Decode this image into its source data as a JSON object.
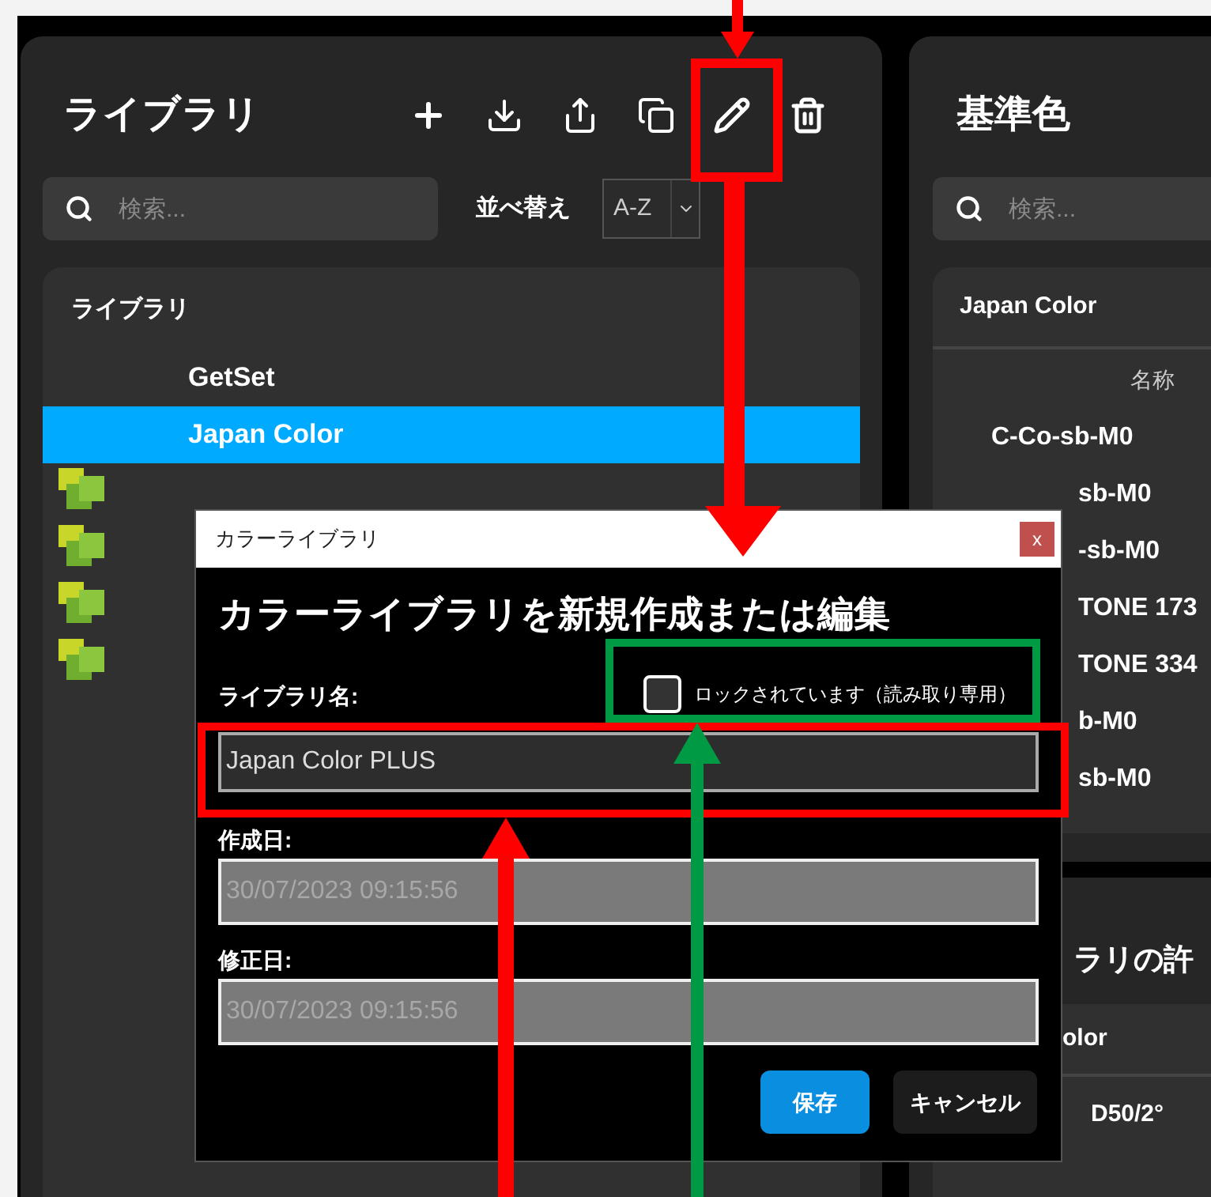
{
  "left_panel": {
    "title": "ライブラリ",
    "search": {
      "placeholder": "検索..."
    },
    "sort": {
      "label": "並べ替え",
      "value": "A-Z"
    },
    "list": {
      "header": "ライブラリ",
      "items": [
        {
          "name": "GetSet",
          "selected": false,
          "has_icon": false
        },
        {
          "name": "Japan Color",
          "selected": true,
          "has_icon": false
        },
        {
          "selected": false,
          "has_icon": true
        },
        {
          "selected": false,
          "has_icon": true
        },
        {
          "selected": false,
          "has_icon": true
        },
        {
          "selected": false,
          "has_icon": true
        }
      ]
    }
  },
  "right_panel": {
    "title": "基準色",
    "search": {
      "placeholder": "検索..."
    },
    "card": {
      "header": "Japan Color",
      "column": "名称",
      "rows": [
        {
          "name": "C-Co-sb-M0",
          "partial": false
        },
        {
          "name": "sb-M0",
          "partial": true
        },
        {
          "name": "-sb-M0",
          "partial": true
        },
        {
          "name": "TONE 173",
          "partial": true
        },
        {
          "name": "TONE 334",
          "partial": true
        },
        {
          "name": "b-M0",
          "partial": true
        },
        {
          "name": "sb-M0",
          "partial": true
        }
      ]
    },
    "section_title": "ラリの許",
    "table": {
      "header": "olor",
      "rows": [
        "D50/2°"
      ]
    }
  },
  "dialog": {
    "title": "カラーライブラリ",
    "close": "x",
    "heading": "カラーライブラリを新規作成または編集",
    "name_label": "ライブラリ名:",
    "locked": {
      "label": "ロックされています（読み取り専用）",
      "checked": false
    },
    "name_value": "Japan Color PLUS",
    "fields": [
      {
        "label": "作成日:",
        "value": "30/07/2023 09:15:56",
        "disabled": true
      },
      {
        "label": "修正日:",
        "value": "30/07/2023 09:15:56",
        "disabled": true
      }
    ],
    "buttons": [
      {
        "label": "保存",
        "kind": "primary"
      },
      {
        "label": "キャンセル",
        "kind": "secondary"
      }
    ]
  }
}
